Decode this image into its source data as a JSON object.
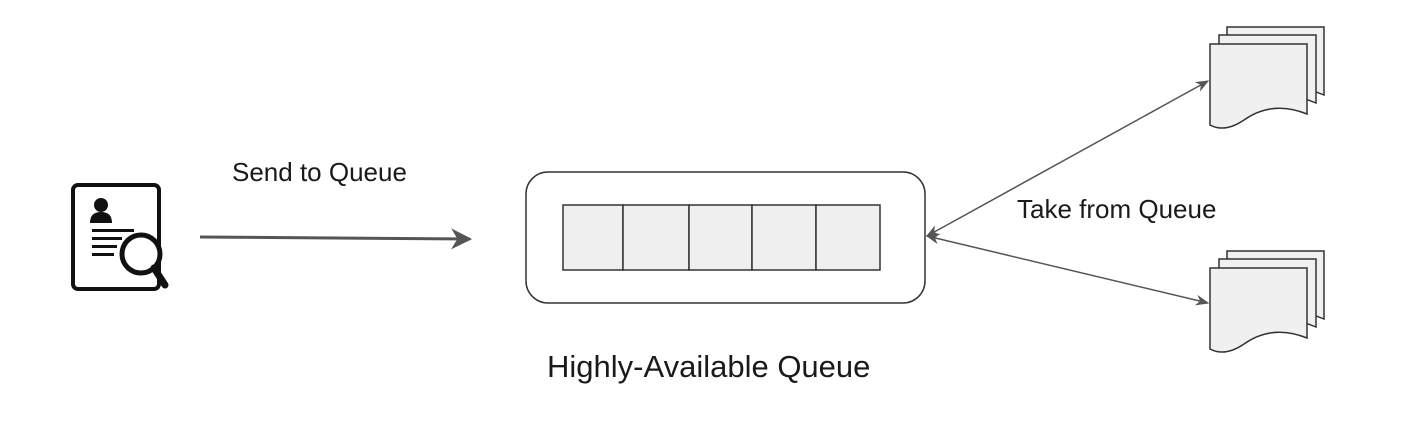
{
  "labels": {
    "send": "Send to Queue",
    "take": "Take from Queue",
    "queue_title": "Highly-Available Queue"
  },
  "queue": {
    "slot_count": 5
  },
  "icons": {
    "producer": "resume-search-icon",
    "consumer_top": "document-stack-icon",
    "consumer_bottom": "document-stack-icon"
  },
  "colors": {
    "slot_fill": "#efefef",
    "stroke": "#333333",
    "arrow": "#555555",
    "page_fill": "#f0f0f0"
  }
}
